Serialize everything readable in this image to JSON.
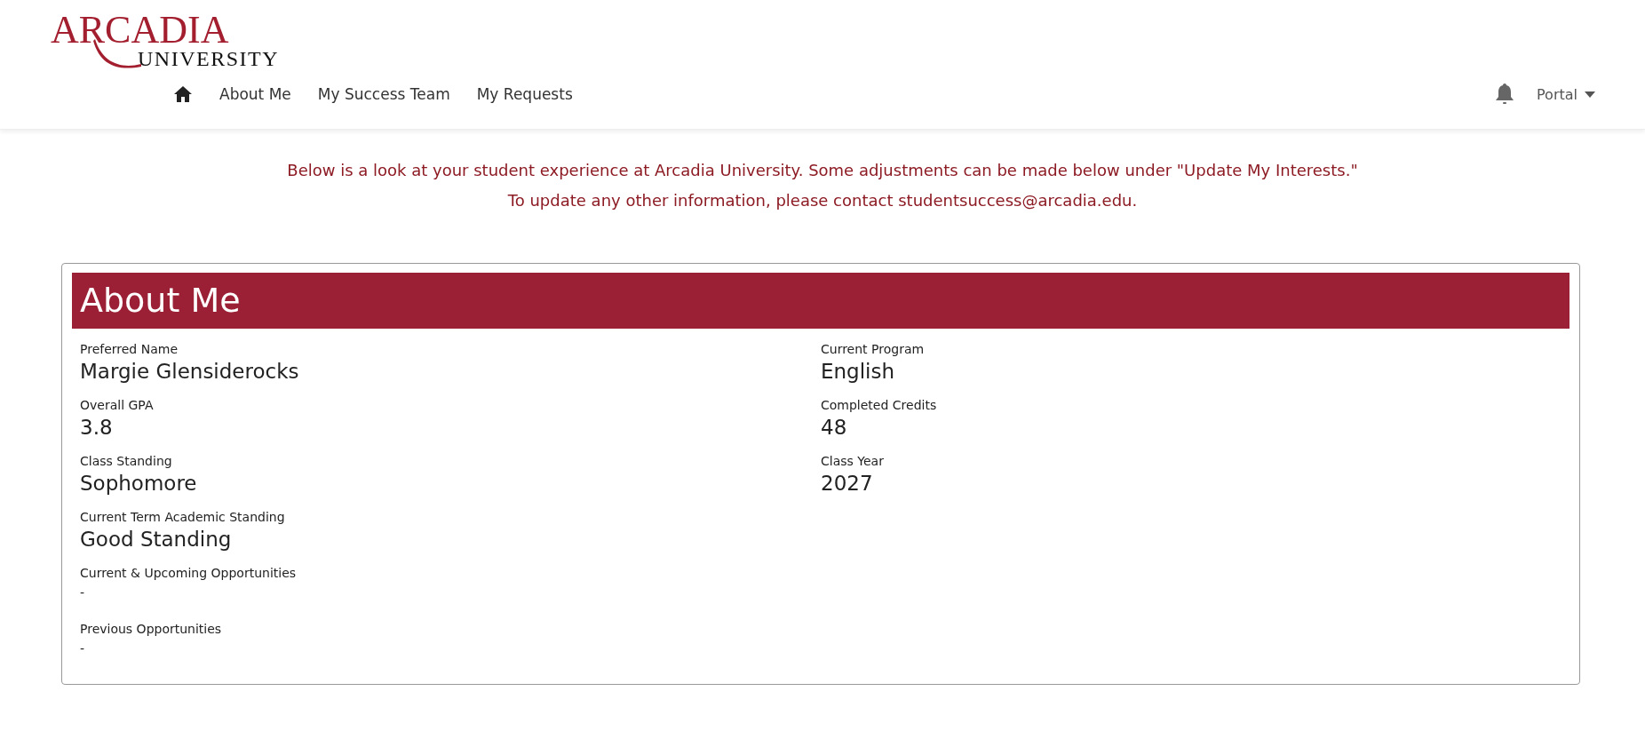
{
  "logo": {
    "top": "ARCADIA",
    "bottom": "UNIVERSITY"
  },
  "nav": {
    "items": [
      {
        "label": "About Me"
      },
      {
        "label": "My Success Team"
      },
      {
        "label": "My Requests"
      }
    ],
    "menu": "Portal"
  },
  "notice": [
    "Below is a look at your student experience at Arcadia University. Some adjustments can be made below under \"Update My Interests.\"",
    "To update any other information, please contact studentsuccess@arcadia.edu."
  ],
  "card": {
    "title": "About Me",
    "left_fields": [
      {
        "label": "Preferred Name",
        "value": "Margie Glensiderocks",
        "kind": "large"
      },
      {
        "label": "Overall GPA",
        "value": "3.8",
        "kind": "large"
      },
      {
        "label": "Class Standing",
        "value": "Sophomore",
        "kind": "large"
      },
      {
        "label": "Current Term Academic Standing",
        "value": "Good Standing",
        "kind": "large"
      },
      {
        "label": "Current & Upcoming Opportunities",
        "value": "-",
        "kind": "plain"
      },
      {
        "label": "Previous Opportunities",
        "value": "-",
        "kind": "plain"
      }
    ],
    "right_fields": [
      {
        "label": "Current Program",
        "value": "English",
        "kind": "large"
      },
      {
        "label": "Completed Credits",
        "value": "48",
        "kind": "large"
      },
      {
        "label": "Class Year",
        "value": "2027",
        "kind": "large"
      }
    ]
  }
}
